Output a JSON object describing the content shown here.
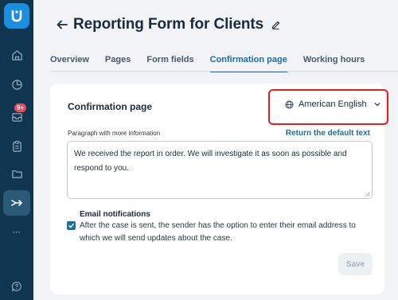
{
  "sidebar": {
    "icons": [
      "logo-icon",
      "home-icon",
      "chart-icon",
      "inbox-icon",
      "clipboard-icon",
      "folder-icon",
      "integrations-icon",
      "more-icon",
      "help-icon"
    ],
    "inbox_badge": "9+",
    "more_label": "···"
  },
  "header": {
    "title": "Reporting Form for Clients"
  },
  "tabs": [
    {
      "label": "Overview",
      "active": false
    },
    {
      "label": "Pages",
      "active": false
    },
    {
      "label": "Form fields",
      "active": false
    },
    {
      "label": "Confirmation page",
      "active": true
    },
    {
      "label": "Working hours",
      "active": false
    }
  ],
  "card": {
    "title": "Confirmation page",
    "language": "American English",
    "field_label": "Paragraph with more information",
    "return_link": "Return the default text",
    "paragraph": "We received the report in order. We will investigate it as soon as possible and respond to you.",
    "notifications_title": "Email notifications",
    "notifications_text": "After the case is sent, the sender has the option to enter their email address to which we will send updates about the case.",
    "notifications_checked": true,
    "save_label": "Save"
  },
  "colors": {
    "sidebar": "#0f3550",
    "accent": "#1c6e9e",
    "highlight": "#e5201e",
    "badge": "#e84a5f"
  }
}
